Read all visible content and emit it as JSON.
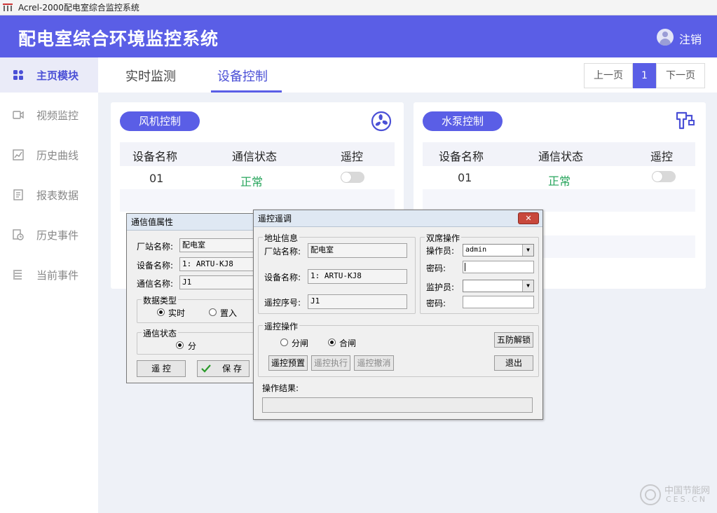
{
  "window": {
    "title": "Acrel-2000配电室综合监控系统"
  },
  "header": {
    "title": "配电室综合环境监控系统",
    "logout": "注销"
  },
  "sidebar": {
    "items": [
      {
        "label": "主页模块",
        "icon": "grid-icon"
      },
      {
        "label": "视频监控",
        "icon": "video-icon"
      },
      {
        "label": "历史曲线",
        "icon": "chart-icon"
      },
      {
        "label": "报表数据",
        "icon": "report-icon"
      },
      {
        "label": "历史事件",
        "icon": "history-icon"
      },
      {
        "label": "当前事件",
        "icon": "list-icon"
      }
    ]
  },
  "tabs": [
    {
      "label": "实时监测"
    },
    {
      "label": "设备控制"
    }
  ],
  "pager": {
    "prev": "上一页",
    "current": "1",
    "next": "下一页"
  },
  "fan_card": {
    "title": "风机控制",
    "icon": "fan-icon",
    "headers": [
      "设备名称",
      "通信状态",
      "遥控"
    ],
    "rows": [
      {
        "name": "01",
        "status": "正常",
        "control_on": false
      }
    ]
  },
  "pump_card": {
    "title": "水泵控制",
    "icon": "pump-icon",
    "headers": [
      "设备名称",
      "通信状态",
      "遥控"
    ],
    "rows": [
      {
        "name": "01",
        "status": "正常",
        "control_on": false
      }
    ]
  },
  "comm_dialog": {
    "title": "通信值属性",
    "station_label": "厂站名称:",
    "station_value": "配电室",
    "device_label": "设备名称:",
    "device_value": "1: ARTU-KJ8",
    "comm_label": "通信名称:",
    "comm_value": "J1",
    "data_type_group": "数据类型",
    "data_type_options": [
      "实时",
      "置入"
    ],
    "data_type_selected": "实时",
    "comm_state_group": "通信状态",
    "comm_state_option": "分",
    "remote_button": "遥 控",
    "save_button": "保 存"
  },
  "remote_dialog": {
    "title": "遥控遥调",
    "address_group": "地址信息",
    "station_label": "厂站名称:",
    "station_value": "配电室",
    "device_label": "设备名称:",
    "device_value": "1: ARTU-KJ8",
    "seq_label": "遥控序号:",
    "seq_value": "J1",
    "dual_group": "双席操作",
    "operator_label": "操作员:",
    "operator_value": "admin",
    "pwd1_label": "密码:",
    "pwd1_value": "",
    "guardian_label": "监护员:",
    "guardian_value": "",
    "pwd2_label": "密码:",
    "pwd2_value": "",
    "op_group": "遥控操作",
    "open_option": "分闸",
    "close_option": "合闸",
    "selected": "合闸",
    "unlock_button": "五防解锁",
    "preset_button": "遥控预置",
    "exec_button": "遥控执行",
    "cancel_button": "遥控撤消",
    "exit_button": "退出",
    "result_label": "操作结果:",
    "result_value": ""
  },
  "watermark": {
    "line1": "中国节能网",
    "line2": "CES.CN"
  },
  "colors": {
    "accent": "#5a5ee6",
    "ok": "#27a55c"
  }
}
